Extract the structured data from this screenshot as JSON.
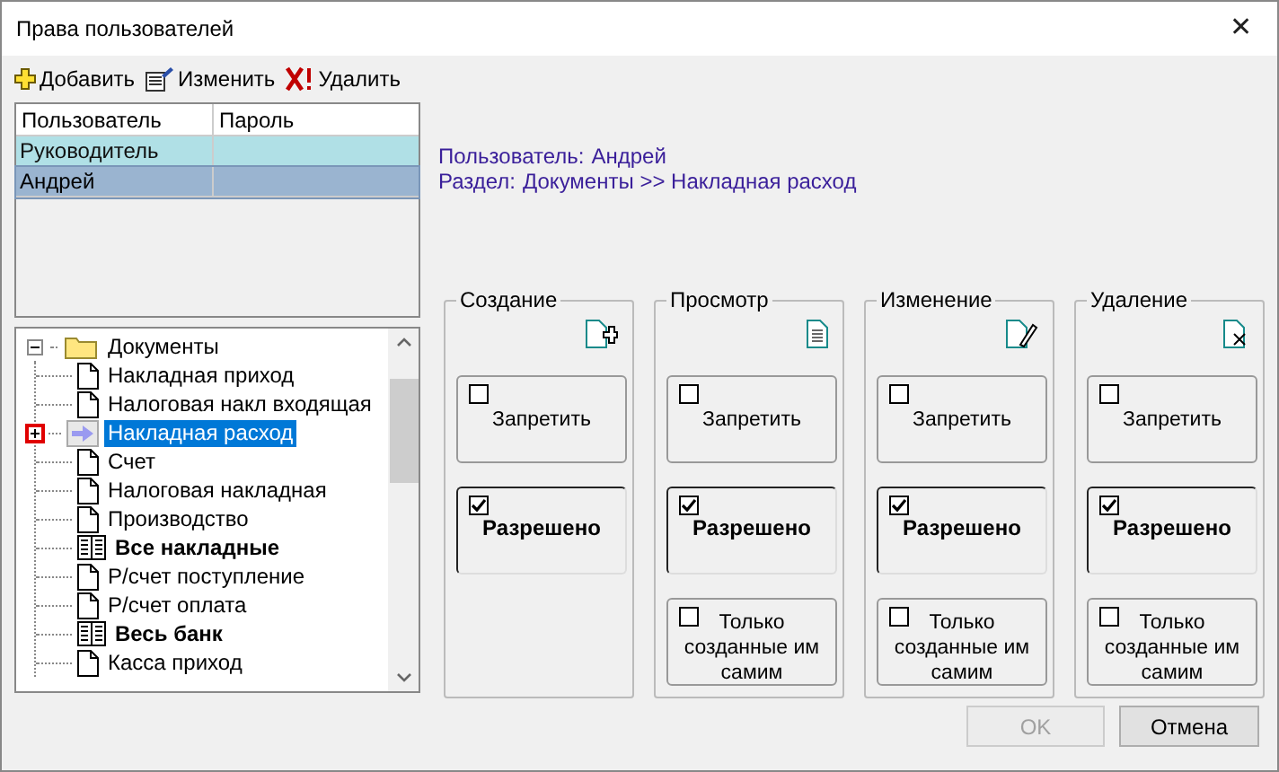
{
  "window": {
    "title": "Права пользователей",
    "close": "✕"
  },
  "toolbar": [
    {
      "kind": "add",
      "label": "Добавить"
    },
    {
      "kind": "edit",
      "label": "Изменить"
    },
    {
      "kind": "delete",
      "label": "Удалить"
    }
  ],
  "users_table": {
    "columns": [
      "Пользователь",
      "Пароль"
    ],
    "rows": [
      {
        "name": "Руководитель",
        "color": "#b0e0e6",
        "selected": false
      },
      {
        "name": "Андрей",
        "color": "#9ab4d0",
        "selected": true
      }
    ]
  },
  "info": [
    {
      "label": "Пользователь:",
      "value": "Андрей"
    },
    {
      "label": "Раздел:",
      "value": "Документы >> Накладная расход"
    }
  ],
  "tree": [
    {
      "label": "Документы",
      "kind": "folder",
      "expanded": true,
      "children": [
        {
          "label": "Накладная приход",
          "kind": "doc",
          "selected": false
        },
        {
          "label": "Налоговая накл входящая",
          "kind": "doc",
          "selected": false
        },
        {
          "label": "Накладная расход",
          "kind": "arrow",
          "selected": true,
          "expanded": false
        },
        {
          "label": "Счет",
          "kind": "doc",
          "selected": false
        },
        {
          "label": "Налоговая накладная",
          "kind": "doc",
          "selected": false
        },
        {
          "label": "Производство",
          "kind": "doc",
          "selected": false
        },
        {
          "label": "Все накладные",
          "kind": "book",
          "selected": false
        },
        {
          "label": "Р/счет поступление",
          "kind": "doc",
          "selected": false
        },
        {
          "label": "Р/счет оплата",
          "kind": "doc",
          "selected": false
        },
        {
          "label": "Весь банк",
          "kind": "book",
          "selected": false
        },
        {
          "label": "Касса приход",
          "kind": "doc",
          "selected": false
        }
      ]
    }
  ],
  "groups": [
    {
      "title": "Создание",
      "kind": "create",
      "options": [
        {
          "label": "Запретить",
          "checked": false
        },
        {
          "label": "Разрешено",
          "checked": true
        }
      ]
    },
    {
      "title": "Просмотр",
      "kind": "view",
      "options": [
        {
          "label": "Запретить",
          "checked": false
        },
        {
          "label": "Разрешено",
          "checked": true
        },
        {
          "label": "Только созданные им самим",
          "checked": false
        }
      ]
    },
    {
      "title": "Изменение",
      "kind": "edit",
      "options": [
        {
          "label": "Запретить",
          "checked": false
        },
        {
          "label": "Разрешено",
          "checked": true
        },
        {
          "label": "Только созданные им самим",
          "checked": false
        }
      ]
    },
    {
      "title": "Удаление",
      "kind": "delete",
      "options": [
        {
          "label": "Запретить",
          "checked": false
        },
        {
          "label": "Разрешено",
          "checked": true
        },
        {
          "label": "Только созданные им самим",
          "checked": false
        }
      ]
    }
  ],
  "buttons": [
    {
      "label": "OK",
      "disabled": true
    },
    {
      "label": "Отмена",
      "disabled": false
    }
  ]
}
